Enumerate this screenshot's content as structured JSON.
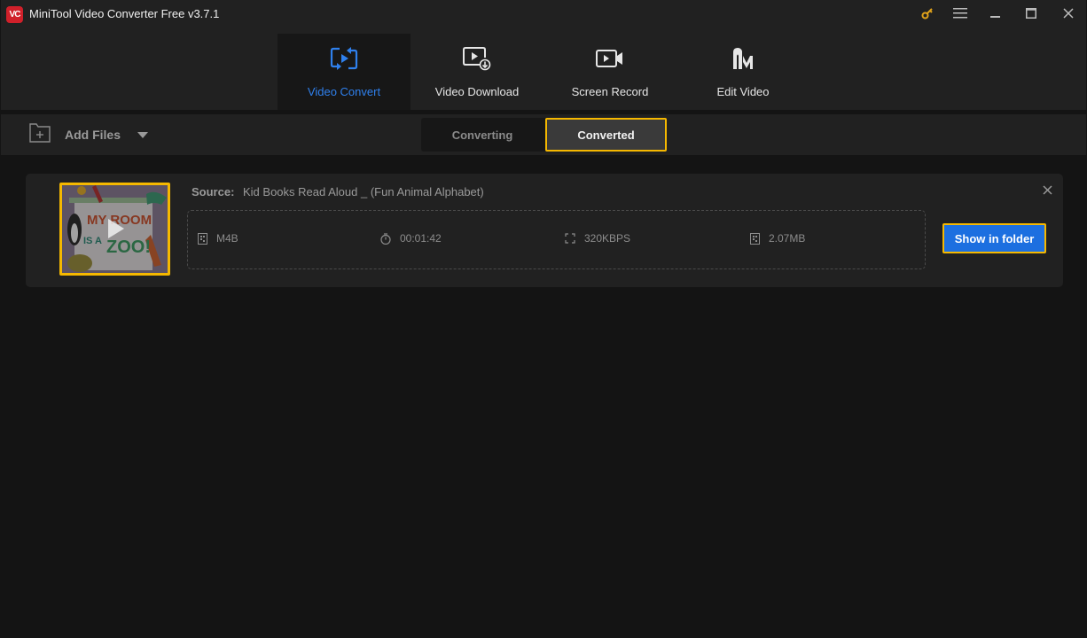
{
  "window": {
    "title": "MiniTool Video Converter Free v3.7.1",
    "logo_text": "VC",
    "controls": [
      "key-icon",
      "menu-icon",
      "minimize-icon",
      "maximize-icon",
      "close-icon"
    ]
  },
  "nav": {
    "items": [
      {
        "label": "Video Convert",
        "icon": "video-convert-icon",
        "active": true
      },
      {
        "label": "Video Download",
        "icon": "video-download-icon",
        "active": false
      },
      {
        "label": "Screen Record",
        "icon": "screen-record-icon",
        "active": false
      },
      {
        "label": "Edit Video",
        "icon": "edit-video-icon",
        "active": false
      }
    ]
  },
  "toolbar": {
    "add_files_label": "Add Files",
    "tabs": [
      {
        "label": "Converting",
        "active": false
      },
      {
        "label": "Converted",
        "active": true
      }
    ]
  },
  "task": {
    "source_label": "Source:",
    "source_name": "Kid Books Read Aloud _ (Fun Animal Alphabet)",
    "thumbnail_text": [
      "MY ROOM",
      "IS A",
      "ZOO!"
    ],
    "format": "M4B",
    "duration": "00:01:42",
    "bitrate": "320KBPS",
    "size": "2.07MB",
    "show_in_folder_label": "Show in folder"
  },
  "colors": {
    "accent_blue": "#2f80ed",
    "button_blue": "#1c6fe0",
    "highlight_yellow": "#f5b800",
    "logo_red": "#d0202a",
    "key_icon": "#e0a21a"
  }
}
